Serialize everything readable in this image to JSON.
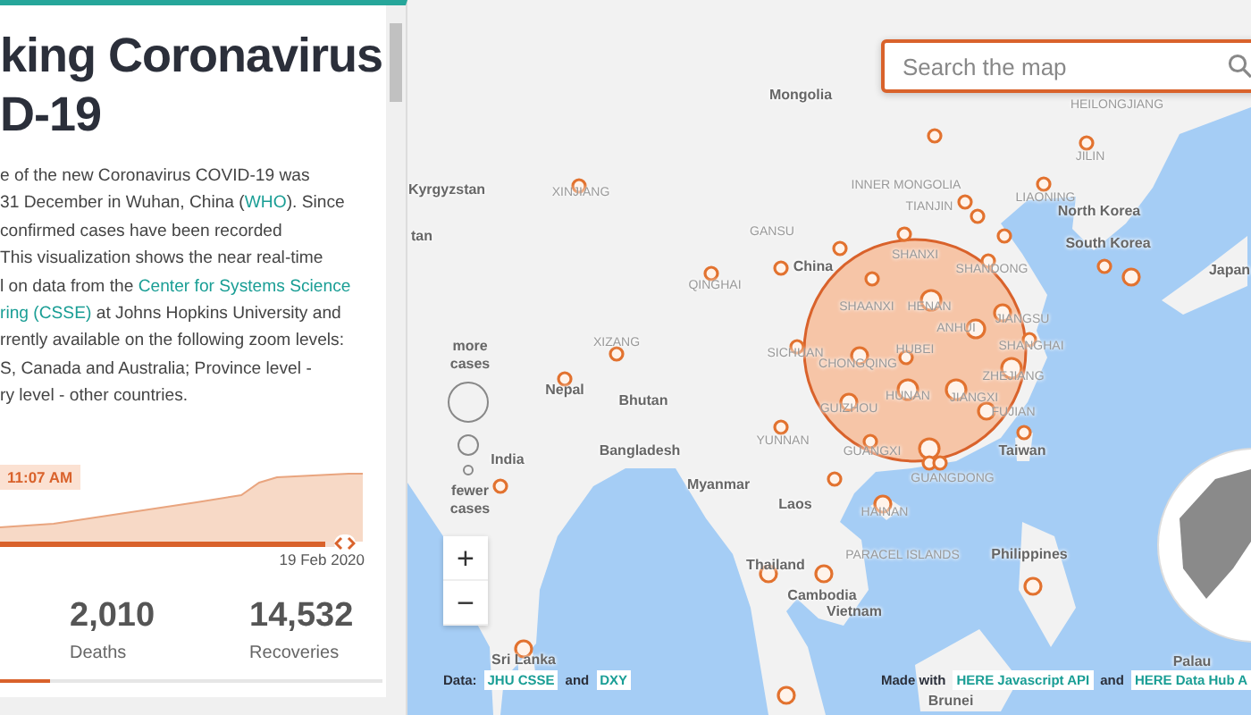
{
  "panel": {
    "title_lines": [
      "king Coronavirus",
      "D-19"
    ],
    "intro": [
      {
        "kind": "text",
        "text": "e of the new Coronavirus COVID-19 was"
      },
      {
        "kind": "break"
      },
      {
        "kind": "text",
        "text": "31 December in Wuhan, China ("
      },
      {
        "kind": "link",
        "text": "WHO"
      },
      {
        "kind": "text",
        "text": "). Since"
      },
      {
        "kind": "break"
      },
      {
        "kind": "text",
        "text": "confirmed cases have been recorded"
      },
      {
        "kind": "break"
      },
      {
        "kind": "text",
        "text": "This visualization shows the near real-time"
      },
      {
        "kind": "break"
      },
      {
        "kind": "text",
        "text": "l on data from the "
      },
      {
        "kind": "link",
        "text": "Center for Systems Science"
      },
      {
        "kind": "break"
      },
      {
        "kind": "link",
        "text": "ring (CSSE)"
      },
      {
        "kind": "text",
        "text": " at Johns Hopkins University and"
      },
      {
        "kind": "break"
      },
      {
        "kind": "text",
        "text": "rrently available on the following zoom levels:"
      },
      {
        "kind": "break"
      },
      {
        "kind": "text",
        "text": "S, Canada and Australia; Province level -"
      },
      {
        "kind": "break"
      },
      {
        "kind": "text",
        "text": "ry level - other countries."
      }
    ],
    "timeline": {
      "time_badge": "11:07 AM",
      "end_date": "19 Feb 2020",
      "level": 0.96
    },
    "stats": [
      {
        "value": "2,010",
        "label": "Deaths"
      },
      {
        "value": "14,532",
        "label": "Recoveries"
      }
    ],
    "progress": {
      "level": 0.13
    }
  },
  "map": {
    "search": {
      "placeholder": "Search the map"
    },
    "labels": [
      {
        "text": "Mongolia",
        "kind": "country"
      },
      {
        "text": "HEILONGJIANG",
        "kind": "region"
      },
      {
        "text": "JILIN",
        "kind": "region"
      },
      {
        "text": "Kyrgyzstan",
        "kind": "country"
      },
      {
        "text": "XINJIANG",
        "kind": "region"
      },
      {
        "text": "INNER MONGOLIA",
        "kind": "region"
      },
      {
        "text": "LIAONING",
        "kind": "region"
      },
      {
        "text": "TIANJIN",
        "kind": "region"
      },
      {
        "text": "North Korea",
        "kind": "country"
      },
      {
        "text": "tan",
        "kind": "country"
      },
      {
        "text": "GANSU",
        "kind": "region"
      },
      {
        "text": "South Korea",
        "kind": "country"
      },
      {
        "text": "SHANXI",
        "kind": "region"
      },
      {
        "text": "China",
        "kind": "country"
      },
      {
        "text": "SHANDONG",
        "kind": "region"
      },
      {
        "text": "Japan",
        "kind": "country"
      },
      {
        "text": "QINGHAI",
        "kind": "region"
      },
      {
        "text": "SHAANXI",
        "kind": "region"
      },
      {
        "text": "HENAN",
        "kind": "region"
      },
      {
        "text": "JIANGSU",
        "kind": "region"
      },
      {
        "text": "ANHUI",
        "kind": "region"
      },
      {
        "text": "XIZANG",
        "kind": "region"
      },
      {
        "text": "HUBEI",
        "kind": "region"
      },
      {
        "text": "SHANGHAI",
        "kind": "region"
      },
      {
        "text": "SICHUAN",
        "kind": "region"
      },
      {
        "text": "CHONGQING",
        "kind": "region"
      },
      {
        "text": "ZHEJIANG",
        "kind": "region"
      },
      {
        "text": "Nepal",
        "kind": "country"
      },
      {
        "text": "Bhutan",
        "kind": "country"
      },
      {
        "text": "HUNAN",
        "kind": "region"
      },
      {
        "text": "JIANGXI",
        "kind": "region"
      },
      {
        "text": "GUIZHOU",
        "kind": "region"
      },
      {
        "text": "FUJIAN",
        "kind": "region"
      },
      {
        "text": "YUNNAN",
        "kind": "region"
      },
      {
        "text": "Bangladesh",
        "kind": "country"
      },
      {
        "text": "GUANGXI",
        "kind": "region"
      },
      {
        "text": "GUANGDONG",
        "kind": "region"
      },
      {
        "text": "Taiwan",
        "kind": "country"
      },
      {
        "text": "India",
        "kind": "country"
      },
      {
        "text": "Myanmar",
        "kind": "country"
      },
      {
        "text": "Laos",
        "kind": "country"
      },
      {
        "text": "HAINAN",
        "kind": "region"
      },
      {
        "text": "Philippines",
        "kind": "country"
      },
      {
        "text": "PARACEL ISLANDS",
        "kind": "region"
      },
      {
        "text": "Thailand",
        "kind": "country"
      },
      {
        "text": "Cambodia",
        "kind": "country"
      },
      {
        "text": "Vietnam",
        "kind": "country"
      },
      {
        "text": "Sri Lanka",
        "kind": "country"
      },
      {
        "text": "Palau",
        "kind": "country"
      },
      {
        "text": "Brunei",
        "kind": "country"
      }
    ],
    "legend": {
      "more": "more cases",
      "fewer": "fewer cases"
    },
    "zoom": {
      "in": "+",
      "out": "−"
    },
    "attribution_data": [
      {
        "kind": "text",
        "text": "Data:"
      },
      {
        "kind": "link",
        "text": "JHU CSSE"
      },
      {
        "kind": "text",
        "text": "and"
      },
      {
        "kind": "link",
        "text": "DXY"
      }
    ],
    "attribution_made": [
      {
        "kind": "text",
        "text": "Made with"
      },
      {
        "kind": "link",
        "text": "HERE Javascript API"
      },
      {
        "kind": "text",
        "text": "and"
      },
      {
        "kind": "link",
        "text": "HERE Data Hub A"
      }
    ]
  }
}
